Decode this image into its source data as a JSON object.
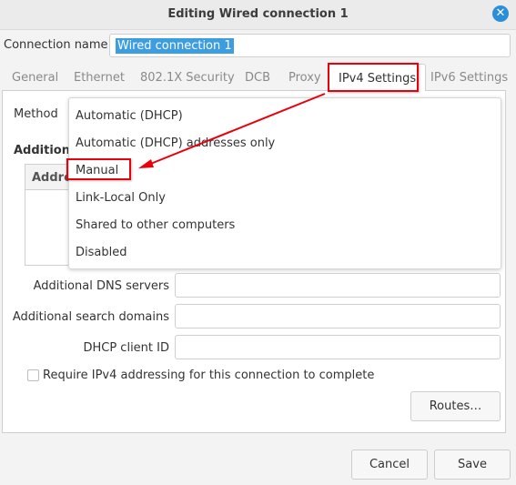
{
  "window": {
    "title": "Editing Wired connection 1",
    "close_icon": "close-icon"
  },
  "connection": {
    "label": "Connection name",
    "value": "Wired connection 1"
  },
  "tabs": [
    {
      "label": "General"
    },
    {
      "label": "Ethernet"
    },
    {
      "label": "802.1X Security"
    },
    {
      "label": "DCB"
    },
    {
      "label": "Proxy"
    },
    {
      "label": "IPv4 Settings",
      "active": true
    },
    {
      "label": "IPv6 Settings"
    }
  ],
  "ipv4": {
    "method_label": "Method",
    "additional_label": "Additional static addresses",
    "addresses_header": "Address",
    "method_options": [
      "Automatic (DHCP)",
      "Automatic (DHCP) addresses only",
      "Manual",
      "Link-Local Only",
      "Shared to other computers",
      "Disabled"
    ],
    "highlighted_option": "Manual",
    "dns_label": "Additional DNS servers",
    "dns_value": "",
    "search_label": "Additional search domains",
    "search_value": "",
    "dhcp_id_label": "DHCP client ID",
    "dhcp_id_value": "",
    "require_label": "Require IPv4 addressing for this connection to complete",
    "require_checked": false,
    "routes_button": "Routes…"
  },
  "footer": {
    "cancel": "Cancel",
    "save": "Save"
  },
  "annotation": {
    "color": "#e8000b"
  }
}
